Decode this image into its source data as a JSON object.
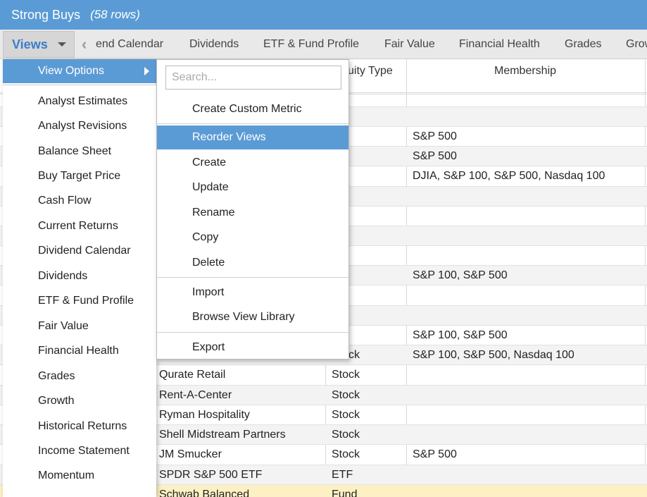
{
  "title": {
    "name": "Strong Buys",
    "rows": "(58 rows)"
  },
  "views_button": {
    "label": "Views"
  },
  "tabs": [
    "end Calendar",
    "Dividends",
    "ETF & Fund Profile",
    "Fair Value",
    "Financial Health",
    "Grades",
    "Grow"
  ],
  "columns": {
    "type": "uity Type",
    "membership": "Membership"
  },
  "rows": [
    {
      "name": "",
      "type": "ck",
      "membership": ""
    },
    {
      "name": "",
      "type": "ck",
      "membership": ""
    },
    {
      "name": "",
      "type": "ck",
      "membership": "S&P 500"
    },
    {
      "name": "",
      "type": "ck",
      "membership": "S&P 500"
    },
    {
      "name": "",
      "type": "ck",
      "membership": "DJIA, S&P 100, S&P 500, Nasdaq 100"
    },
    {
      "name": "",
      "type": "ck",
      "membership": ""
    },
    {
      "name": "",
      "type": "ck",
      "membership": ""
    },
    {
      "name": "",
      "type": "ck",
      "membership": ""
    },
    {
      "name": "",
      "type": "ck",
      "membership": ""
    },
    {
      "name": "",
      "type": "ck",
      "membership": "S&P 100, S&P 500"
    },
    {
      "name": "",
      "type": "",
      "membership": ""
    },
    {
      "name": "",
      "type": "ck",
      "membership": ""
    },
    {
      "name": "",
      "type": "ck",
      "membership": "S&P 100, S&P 500"
    },
    {
      "name": "",
      "type": "Stock",
      "membership": "S&P 100, S&P 500, Nasdaq 100"
    },
    {
      "name": "Qurate Retail",
      "type": "Stock",
      "membership": ""
    },
    {
      "name": "Rent-A-Center",
      "type": "Stock",
      "membership": ""
    },
    {
      "name": "Ryman Hospitality",
      "type": "Stock",
      "membership": ""
    },
    {
      "name": "Shell Midstream Partners",
      "type": "Stock",
      "membership": ""
    },
    {
      "name": "JM Smucker",
      "type": "Stock",
      "membership": "S&P 500"
    },
    {
      "name": "SPDR S&P 500 ETF",
      "type": "ETF",
      "membership": ""
    },
    {
      "name": "Schwab Balanced",
      "type": "Fund",
      "membership": ""
    }
  ],
  "views_menu": {
    "header": "View Options",
    "items": [
      "Analyst Estimates",
      "Analyst Revisions",
      "Balance Sheet",
      "Buy Target Price",
      "Cash Flow",
      "Current Returns",
      "Dividend Calendar",
      "Dividends",
      "ETF & Fund Profile",
      "Fair Value",
      "Financial Health",
      "Grades",
      "Growth",
      "Historical Returns",
      "Income Statement",
      "Momentum"
    ]
  },
  "submenu": {
    "search_placeholder": "Search...",
    "create_metric": "Create Custom Metric",
    "group": [
      "Reorder Views",
      "Create",
      "Update",
      "Rename",
      "Copy",
      "Delete"
    ],
    "import": "Import",
    "browse": "Browse View Library",
    "export": "Export"
  }
}
